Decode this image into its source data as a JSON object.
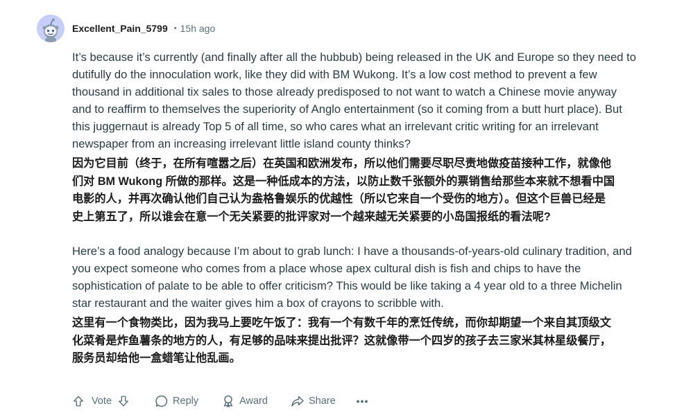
{
  "comment": {
    "author": "Excellent_Pain_5799",
    "separator": "•",
    "time_ago": "15h ago",
    "paragraphs": [
      {
        "lang": "en",
        "text": "It’s because it’s currently (and finally after all the hubbub) being released in the UK and Europe so they need to\ndutifully do the innoculation work, like they did with BM Wukong. It’s a low cost method to prevent a few\nthousand in additional tix sales to those already predisposed to not want to watch a Chinese movie anyway\nand to reaffirm to themselves the superiority of Anglo entertainment (so it coming from a butt hurt place). But\nthis juggernaut is already Top 5 of all time, so who cares what an irrelevant critic writing for an irrelevant\nnewspaper from an increasing irrelevant little island county thinks?"
      },
      {
        "lang": "zh",
        "text": "因为它目前（终于，在所有喧嚣之后）在英国和欧洲发布，所以他们需要尽职尽责地做疫苗接种工作，就像他\n们对 BM Wukong 所做的那样。这是一种低成本的方法，以防止数千张额外的票销售给那些本来就不想看中国\n电影的人，并再次确认他们自己认为盎格鲁娱乐的优越性（所以它来自一个受伤的地方）。但这个巨兽已经是\n史上第五了，所以谁会在意一个无关紧要的批评家对一个越来越无关紧要的小岛国报纸的看法呢?"
      },
      {
        "lang": "en",
        "text": "Here’s a food analogy because I’m about to grab lunch: I have a thousands-of-years-old culinary tradition, and\nyou expect someone who comes from a place whose apex cultural dish is fish and chips to have the\nsophistication of palate to be able to offer criticism? This would be like taking a 4 year old to a three Michelin\nstar restaurant and the waiter gives him a box of crayons to scribble with."
      },
      {
        "lang": "zh",
        "text": "这里有一个食物类比，因为我马上要吃午饭了：我有一个有数千年的烹饪传统，而你却期望一个来自其顶级文\n化菜肴是炸鱼薯条的地方的人，有足够的品味来提出批评？这就像带一个四岁的孩子去三家米其林星级餐厅，\n服务员却给他一盒蜡笔让他乱画。"
      }
    ]
  },
  "actions": {
    "vote_label": "Vote",
    "reply_label": "Reply",
    "award_label": "Award",
    "share_label": "Share",
    "more_label": "•••"
  },
  "icons": {
    "avatar": "snoo-avatar-icon",
    "upvote": "upvote-arrow-icon",
    "downvote": "downvote-arrow-icon",
    "reply": "speech-bubble-icon",
    "award": "award-ribbon-icon",
    "share": "share-arrow-icon",
    "more": "more-options-icon"
  },
  "colors": {
    "avatar_bg": "#c6cff7",
    "meta_text": "#576f76",
    "body_text": "#2a3c42",
    "strong_text": "#1c1c1c"
  }
}
